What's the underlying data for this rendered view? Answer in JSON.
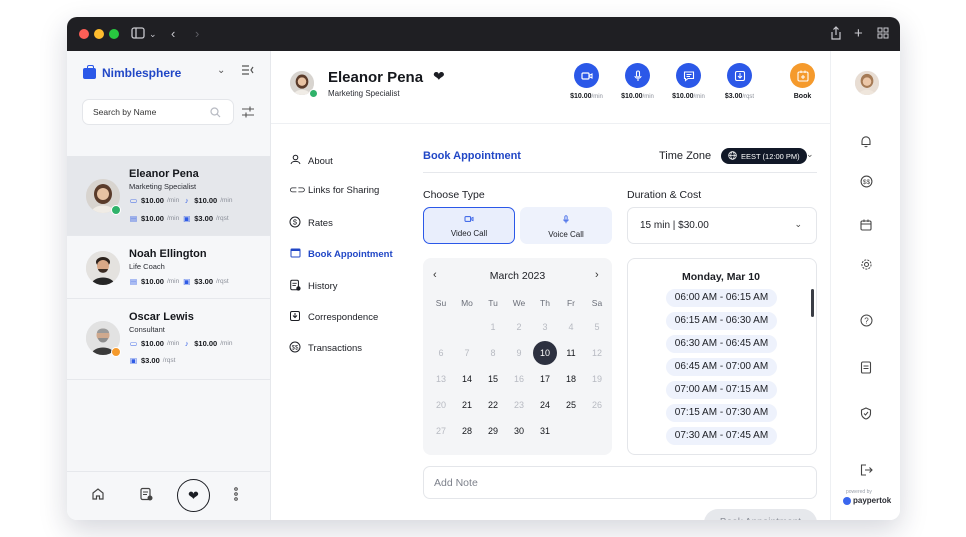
{
  "colors": {
    "accent": "#2b58e8",
    "orange": "#f59a2c",
    "online": "#2fb26a",
    "dark": "#111827"
  },
  "sidebar": {
    "brand": "Nimblesphere",
    "search_placeholder": "Search by Name",
    "contacts": [
      {
        "name": "Eleanor Pena",
        "role": "Marketing Specialist",
        "rates": [
          {
            "icon": "video-icon",
            "value": "$10.00",
            "unit": "/min"
          },
          {
            "icon": "mic-icon",
            "value": "$10.00",
            "unit": "/min"
          },
          {
            "icon": "chat-icon",
            "value": "$10.00",
            "unit": "/min"
          },
          {
            "icon": "request-icon",
            "value": "$3.00",
            "unit": "/rqst"
          }
        ]
      },
      {
        "name": "Noah Ellington",
        "role": "Life Coach",
        "rates": [
          {
            "icon": "chat-icon",
            "value": "$10.00",
            "unit": "/min"
          },
          {
            "icon": "request-icon",
            "value": "$3.00",
            "unit": "/rqst"
          }
        ]
      },
      {
        "name": "Oscar Lewis",
        "role": "Consultant",
        "rates": [
          {
            "icon": "video-icon",
            "value": "$10.00",
            "unit": "/min"
          },
          {
            "icon": "mic-icon",
            "value": "$10.00",
            "unit": "/min"
          },
          {
            "icon": "request-icon",
            "value": "$3.00",
            "unit": "/rqst"
          }
        ]
      }
    ]
  },
  "profile": {
    "name": "Eleanor Pena",
    "role": "Marketing Specialist",
    "actions": [
      {
        "icon": "video-icon",
        "value": "$10.00",
        "unit": "/min"
      },
      {
        "icon": "mic-icon",
        "value": "$10.00",
        "unit": "/min"
      },
      {
        "icon": "chat-icon",
        "value": "$10.00",
        "unit": "/min"
      },
      {
        "icon": "request-icon",
        "value": "$3.00",
        "unit": "/rqst"
      },
      {
        "icon": "calendar-plus-icon",
        "value": "Book",
        "unit": ""
      }
    ]
  },
  "menu": [
    {
      "icon": "user-icon",
      "label": "About"
    },
    {
      "icon": "link-icon",
      "label": "Links for Sharing"
    },
    {
      "icon": "dollar-icon",
      "label": "Rates"
    },
    {
      "icon": "calendar-icon",
      "label": "Book Appointment"
    },
    {
      "icon": "history-icon",
      "label": "History"
    },
    {
      "icon": "inbox-icon",
      "label": "Correspondence"
    },
    {
      "icon": "money-icon",
      "label": "Transactions"
    }
  ],
  "booking": {
    "title": "Book Appointment",
    "timezone_label": "Time Zone",
    "timezone_value": "EEST (12:00 PM)",
    "choose_type_label": "Choose Type",
    "type_video": "Video Call",
    "type_voice": "Voice Call",
    "duration_label": "Duration & Cost",
    "duration_value": "15 min | $30.00",
    "month": "March  2023",
    "weekdays": [
      "Su",
      "Mo",
      "Tu",
      "We",
      "Th",
      "Fr",
      "Sa"
    ],
    "weeks": [
      [
        "",
        "",
        "1",
        "2",
        "3",
        "4",
        "5"
      ],
      [
        "6",
        "7",
        "8",
        "9",
        "10",
        "11",
        "12"
      ],
      [
        "13",
        "14",
        "15",
        "16",
        "17",
        "18",
        "19"
      ],
      [
        "20",
        "21",
        "22",
        "23",
        "24",
        "25",
        "26"
      ],
      [
        "27",
        "28",
        "29",
        "30",
        "31",
        "",
        ""
      ]
    ],
    "available_days": [
      "11",
      "14",
      "15",
      "17",
      "18",
      "21",
      "22",
      "24",
      "25",
      "28",
      "29",
      "30",
      "31"
    ],
    "selected_day": "10",
    "slots_title": "Monday, Mar 10",
    "slots": [
      "06:00 AM - 06:15 AM",
      "06:15 AM - 06:30 AM",
      "06:30 AM - 06:45 AM",
      "06:45 AM - 07:00 AM",
      "07:00 AM - 07:15 AM",
      "07:15 AM - 07:30 AM",
      "07:30 AM - 07:45 AM"
    ],
    "note_placeholder": "Add Note",
    "submit_label": "Book Appointment"
  },
  "rail": {
    "powered_by": "powered by",
    "logo": "paypertok"
  }
}
